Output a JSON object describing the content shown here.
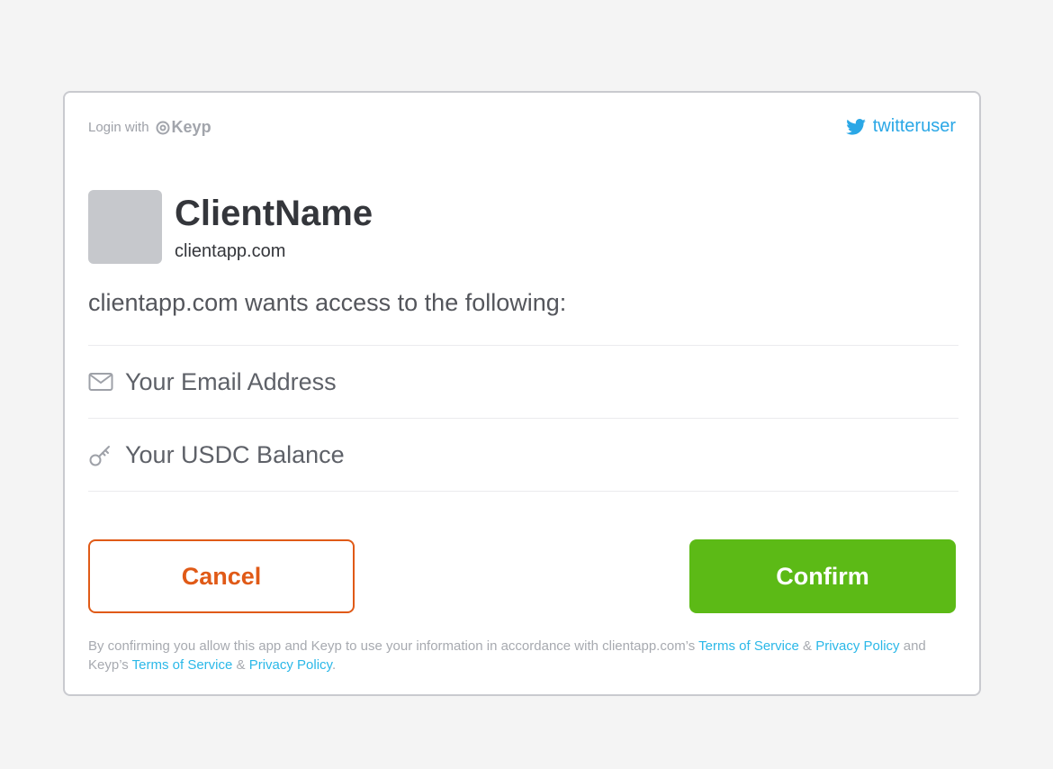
{
  "header": {
    "login_with": "Login with",
    "brand_name": "Keyp",
    "account_username": "twitteruser",
    "account_icon": "twitter-bird-icon"
  },
  "client": {
    "name": "ClientName",
    "domain": "clientapp.com"
  },
  "request_heading": "clientapp.com wants access to the following:",
  "permissions": [
    {
      "label": "Your Email Address",
      "icon": "envelope-icon"
    },
    {
      "label": "Your USDC Balance",
      "icon": "key-icon"
    }
  ],
  "actions": {
    "cancel_label": "Cancel",
    "confirm_label": "Confirm"
  },
  "legal": {
    "part1": "By confirming you allow this app and Keyp to use your information in accordance with clientapp.com’s ",
    "client_terms": "Terms of Service",
    "amp1": " & ",
    "client_privacy": "Privacy Policy",
    "part2": " and Keyp’s ",
    "keyp_terms": "Terms of Service",
    "amp2": " & ",
    "keyp_privacy": "Privacy Policy",
    "end": "."
  },
  "colors": {
    "accent_cancel": "#e05a17",
    "accent_confirm": "#5cba16",
    "link": "#2bb8e8",
    "twitter": "#2aa7e6"
  }
}
